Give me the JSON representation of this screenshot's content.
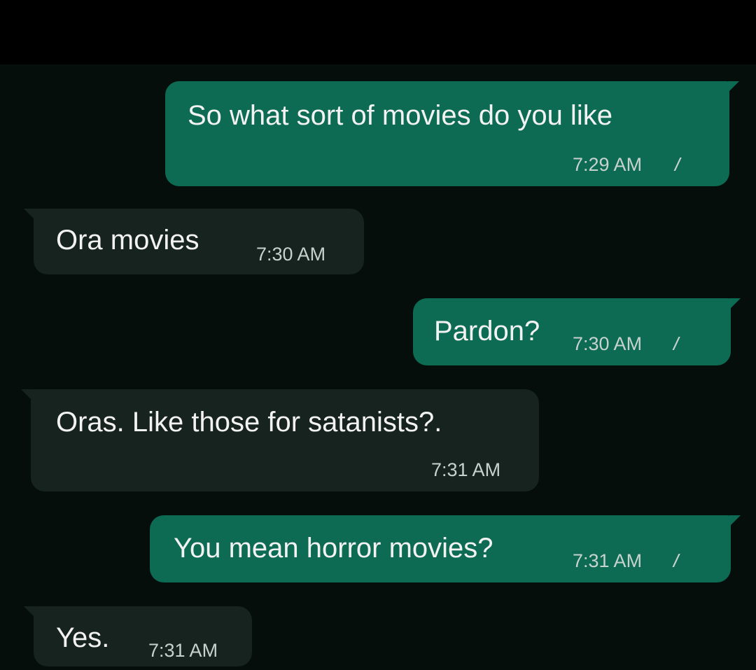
{
  "messages": [
    {
      "direction": "outgoing",
      "text": "So what sort of movies do you like",
      "time": "7:29 AM",
      "status_icon": "double-check-icon"
    },
    {
      "direction": "incoming",
      "text": "Ora movies",
      "time": "7:30 AM"
    },
    {
      "direction": "outgoing",
      "text": "Pardon?",
      "time": "7:30 AM",
      "status_icon": "double-check-icon"
    },
    {
      "direction": "incoming",
      "text": "Oras. Like those for satanists?.",
      "time": "7:31 AM"
    },
    {
      "direction": "outgoing",
      "text": "You mean horror movies?",
      "time": "7:31 AM",
      "status_icon": "double-check-icon"
    },
    {
      "direction": "incoming",
      "text": "Yes.",
      "time": "7:31 AM"
    }
  ],
  "read_ticks": "//",
  "colors": {
    "outgoing_bubble": "#0d6b54",
    "incoming_bubble": "#17231f",
    "background": "#050e0b",
    "text": "#f2f2f2",
    "time": "#c7d2ce"
  }
}
